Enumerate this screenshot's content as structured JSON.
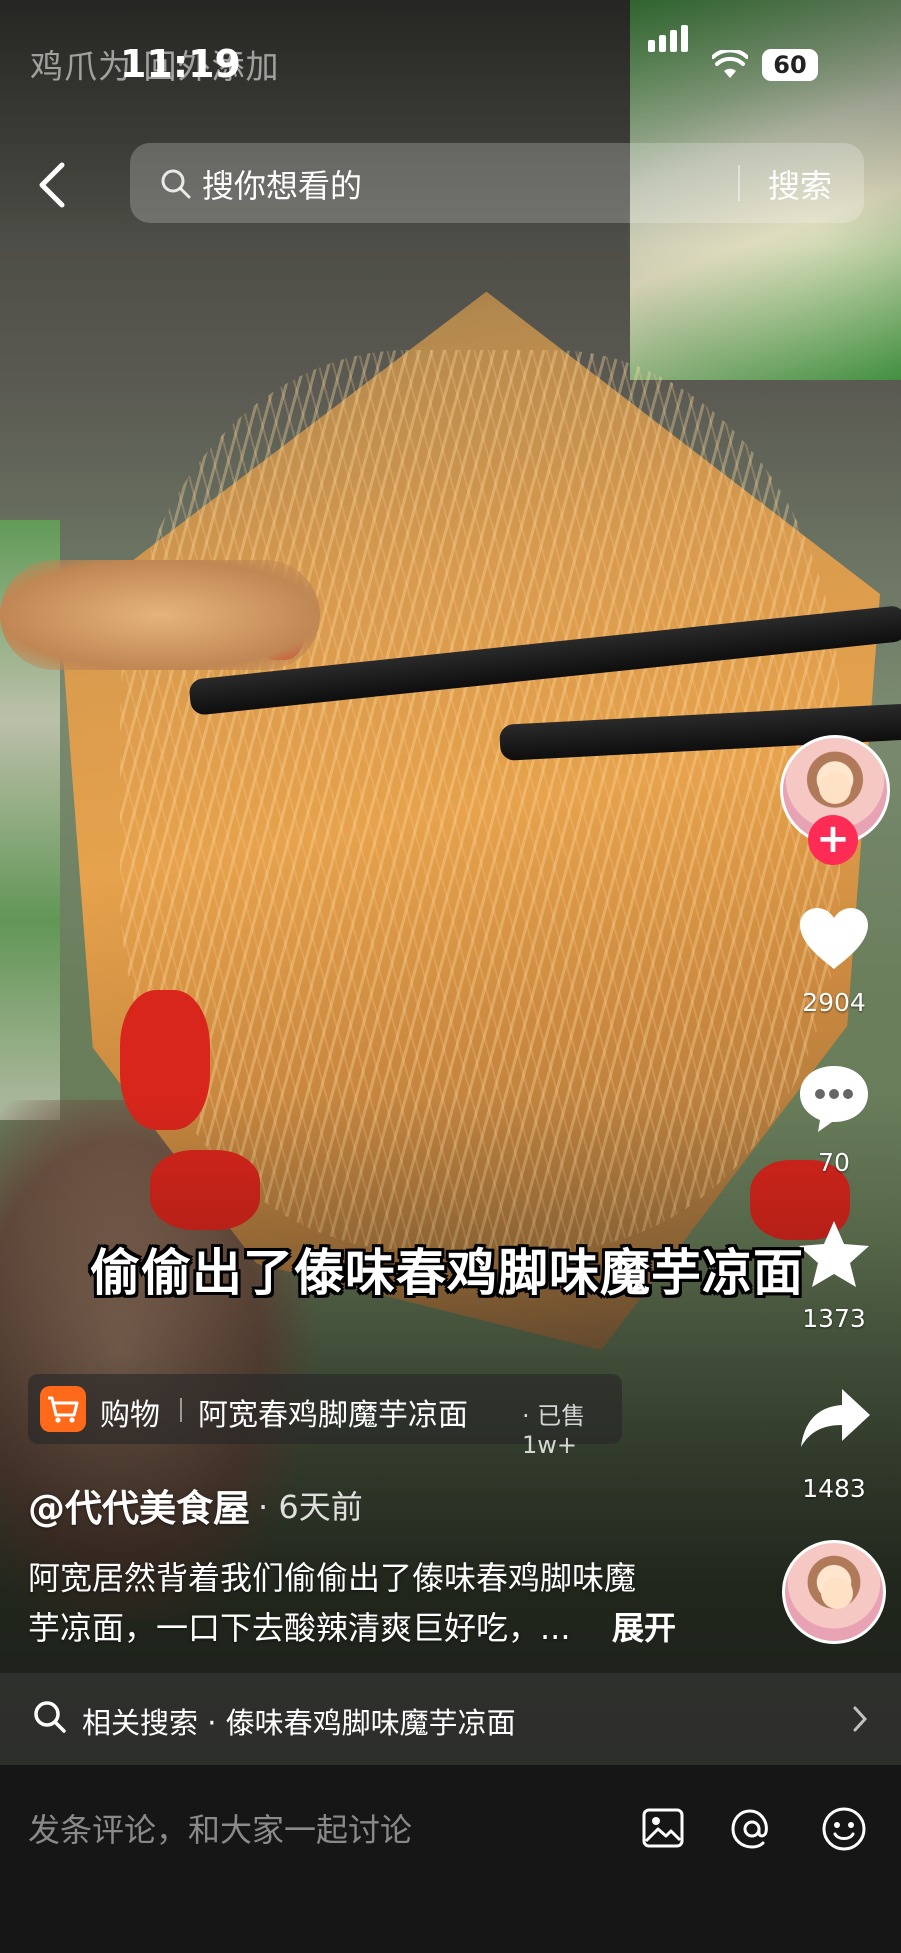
{
  "status_bar": {
    "notification_ghost": "鸡爪为 回外添加",
    "time": "11:19",
    "battery": "60"
  },
  "search": {
    "placeholder": "搜你想看的",
    "button_label": "搜索"
  },
  "video": {
    "caption": "偷偷出了傣味春鸡脚味魔芋凉面"
  },
  "actions": {
    "likes": "2904",
    "comments": "70",
    "favorites": "1373",
    "shares": "1483"
  },
  "shopping": {
    "label": "购物",
    "product": "阿宽春鸡脚魔芋凉面",
    "sold": "· 已售1w+"
  },
  "post": {
    "author": "@代代美食屋",
    "time": "· 6天前",
    "description_line1": "阿宽居然背着我们偷偷出了傣味春鸡脚味魔",
    "description_line2": "芋凉面，一口下去酸辣清爽巨好吃，...",
    "expand": "展开"
  },
  "related_search": {
    "text": "相关搜索 · 傣味春鸡脚味魔芋凉面"
  },
  "comment_bar": {
    "placeholder": "发条评论，和大家一起讨论"
  },
  "icons": {
    "back": "chevron-left-icon",
    "search": "search-icon",
    "like": "heart-icon",
    "comment": "comment-bubble-icon",
    "favorite": "star-icon",
    "share": "share-arrow-icon",
    "shop": "cart-icon",
    "image": "image-icon",
    "mention": "at-icon",
    "emoji": "smiley-icon"
  },
  "colors": {
    "follow_accent": "#fe2c55",
    "shop_accent": "#ff6a1a",
    "comment_bar_bg": "#161616"
  }
}
